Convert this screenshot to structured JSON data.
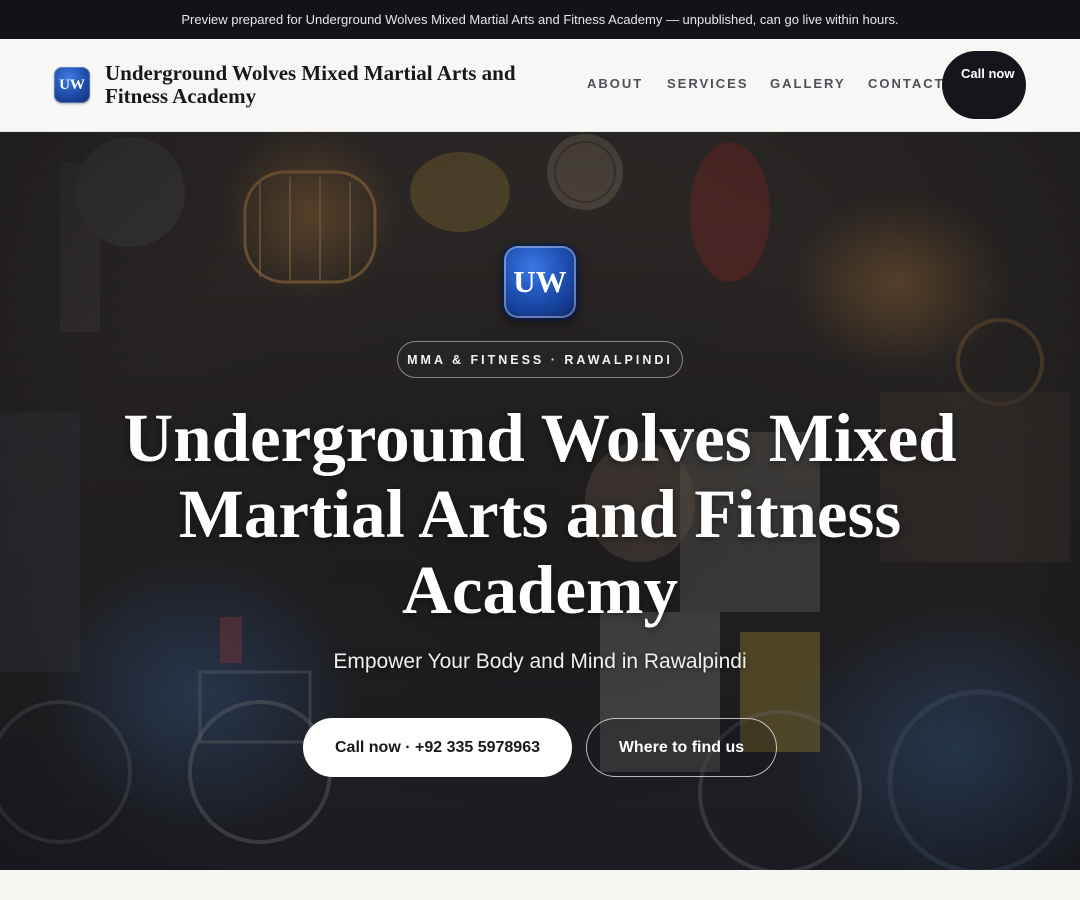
{
  "preview_banner": {
    "text": "Preview prepared for Underground Wolves Mixed Martial Arts and Fitness Academy — unpublished, can go live within hours."
  },
  "header": {
    "logo_initials": "UW",
    "brand_name": "Underground Wolves Mixed Martial Arts and Fitness Academy",
    "nav": [
      {
        "label": "ABOUT"
      },
      {
        "label": "SERVICES"
      },
      {
        "label": "GALLERY"
      },
      {
        "label": "CONTACT"
      }
    ],
    "call_button": "Call now"
  },
  "hero": {
    "logo_initials": "UW",
    "tag": "MMA & FITNESS · RAWALPINDI",
    "title": "Underground Wolves Mixed Martial Arts and Fitness Academy",
    "subtitle": "Empower Your Body and Mind in Rawalpindi",
    "primary_button": "Call now · +92 335 5978963",
    "secondary_button": "Where to find us"
  },
  "colors": {
    "topbar_bg": "#111318",
    "header_bg": "#f7f7f5",
    "accent_blue": "#1d4ca8",
    "dark_button": "#14161b"
  }
}
